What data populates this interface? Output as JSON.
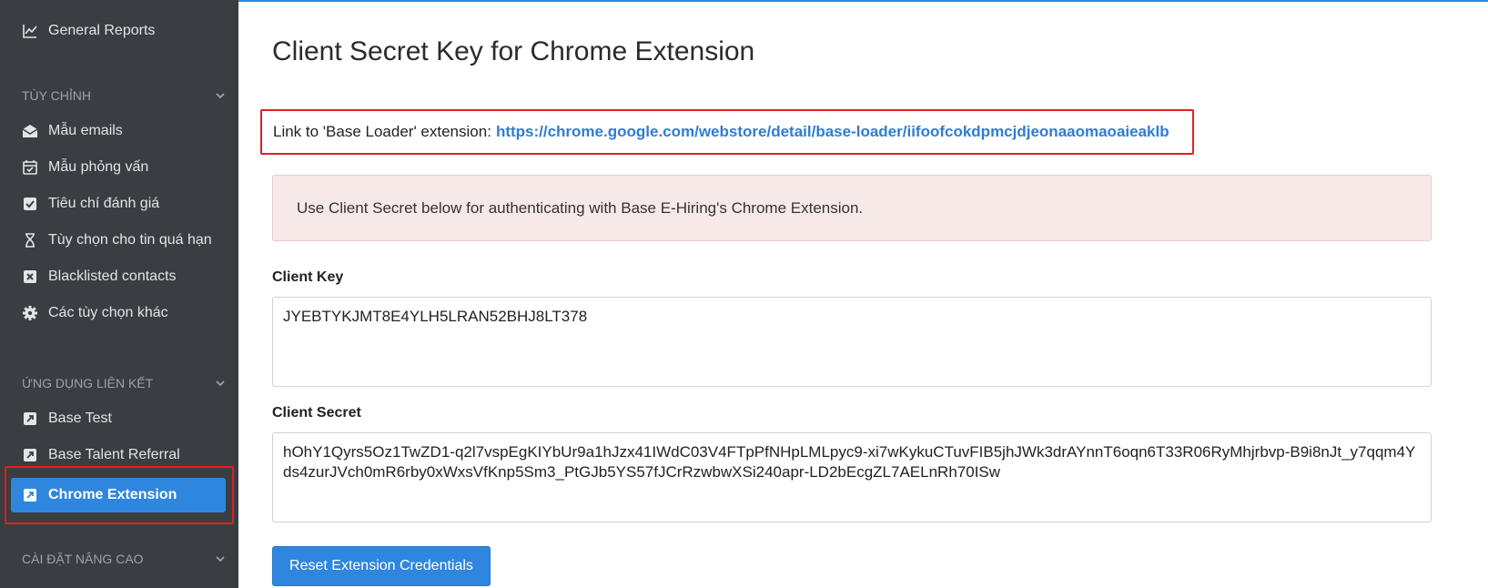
{
  "sidebar": {
    "items_top": [
      {
        "label": "General Reports",
        "icon": "chart-line-icon"
      }
    ],
    "sections": [
      {
        "label": "TÙY CHỈNH"
      },
      {
        "label": "ỨNG DỤNG LIÊN KẾT"
      },
      {
        "label": "CÀI ĐẶT NÂNG CAO"
      }
    ],
    "customize_items": [
      {
        "label": "Mẫu emails",
        "icon": "envelope-open-icon"
      },
      {
        "label": "Mẫu phỏng vấn",
        "icon": "calendar-check-icon"
      },
      {
        "label": "Tiêu chí đánh giá",
        "icon": "checkbox-icon"
      },
      {
        "label": "Tùy chọn cho tin quá hạn",
        "icon": "hourglass-icon"
      },
      {
        "label": "Blacklisted contacts",
        "icon": "x-box-icon"
      },
      {
        "label": "Các tùy chọn khác",
        "icon": "gear-icon"
      }
    ],
    "apps_items": [
      {
        "label": "Base Test",
        "icon": "external-link-icon"
      },
      {
        "label": "Base Talent Referral",
        "icon": "external-link-icon"
      },
      {
        "label": "Chrome Extension",
        "icon": "external-link-icon",
        "active": true
      }
    ]
  },
  "main": {
    "title": "Client Secret Key for Chrome Extension",
    "link_prefix": "Link to 'Base Loader' extension:",
    "link_url": "https://chrome.google.com/webstore/detail/base-loader/iifoofcokdpmcjdjeonaaomaoaieaklb",
    "alert_text": "Use Client Secret below for authenticating with Base E-Hiring's Chrome Extension.",
    "client_key_label": "Client Key",
    "client_key_value": "JYEBTYKJMT8E4YLH5LRAN52BHJ8LT378",
    "client_secret_label": "Client Secret",
    "client_secret_value": "hOhY1Qyrs5Oz1TwZD1-q2l7vspEgKIYbUr9a1hJzx41IWdC03V4FTpPfNHpLMLpyc9-xi7wKykuCTuvFIB5jhJWk3drAYnnT6oqn6T33R06RyMhjrbvp-B9i8nJt_y7qqm4Yds4zurJVch0mR6rby0xWxsVfKnp5Sm3_PtGJb5YS57fJCrRzwbwXSi240apr-LD2bEcgZL7AELnRh70ISw",
    "reset_button": "Reset Extension Credentials"
  },
  "colors": {
    "sidebar_bg": "#3a3d42",
    "accent": "#2f86de",
    "highlight": "#e02020",
    "alert_bg": "#f8e9e9",
    "link": "#2f7cd3"
  }
}
